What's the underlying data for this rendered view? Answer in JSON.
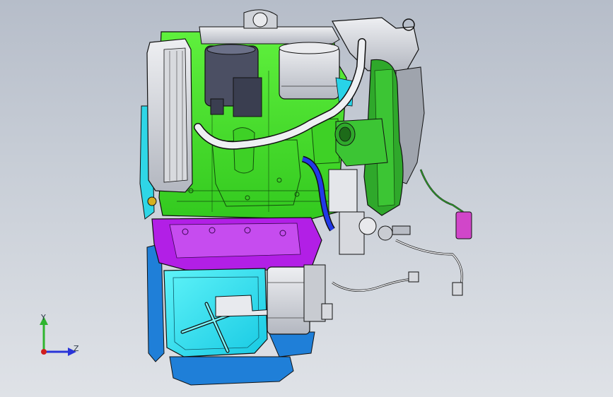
{
  "viewport": {
    "background_top": "#b6bdc9",
    "background_bottom": "#dfe2e7"
  },
  "model": {
    "icon": "engine-assembly-model",
    "colors": {
      "block": "#43e22a",
      "head": "#d9dbe0",
      "head_dark": "#9ea3ad",
      "oil_pan": "#24e6f0",
      "oil_pan_dark": "#19a8c4",
      "oil_pan_blue": "#1f7fd8",
      "adapter": "#b21fe6",
      "hose": "#2239e8",
      "intake": "#2fa82b",
      "connector": "#d146c9",
      "outline": "#1a1a1a"
    }
  },
  "triad": {
    "y_label": "Y",
    "z_label": "Z",
    "y_color": "#2fb52f",
    "z_color": "#2a34d8",
    "x_color": "#d01f1f"
  }
}
